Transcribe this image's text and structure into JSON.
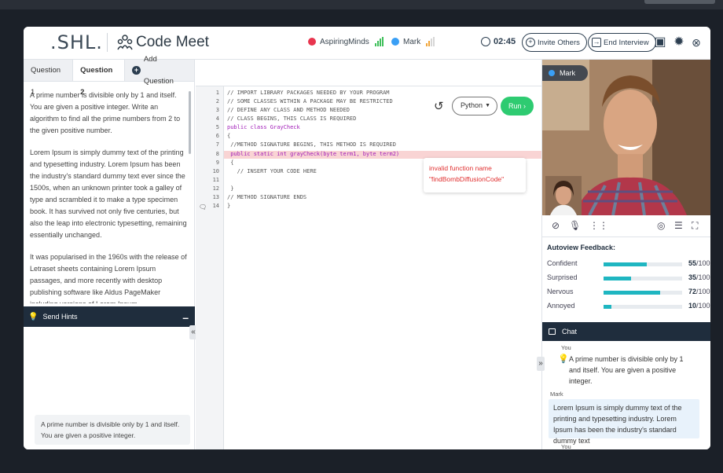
{
  "header": {
    "logo": ".SHL.",
    "app_title": "Code Meet",
    "participants": [
      {
        "name": "AspiringMinds",
        "dot_color": "#e8354e"
      },
      {
        "name": "Mark",
        "dot_color": "#3a9ff5"
      }
    ],
    "timer": "02:45",
    "invite_label": "Invite Others",
    "end_label": "End Interview"
  },
  "tabs": {
    "q1": "Question 1",
    "q2": "Question 2",
    "add": "Add Question"
  },
  "question": {
    "para1": "A prime number is divisible only by 1 and itself. You are given a positive integer. Write an algorithm to find all the prime numbers from 2 to the given positive number.",
    "para2": "Lorem Ipsum is simply dummy text of the printing and typesetting industry. Lorem Ipsum has been the industry's standard dummy text ever since the 1500s, when an unknown printer took a galley of type and scrambled it to make a type specimen book. It has survived not only five centuries, but also the leap into electronic typesetting, remaining essentially unchanged.",
    "para3": "It was popularised in the 1960s with the release of Letraset sheets containing Lorem Ipsum passages, and more recently with desktop publishing software like Aldus PageMaker including versions of Lorem Ipsum."
  },
  "hints": {
    "label": "Send Hints",
    "card": "A prime number is divisible only by 1 and itself. You are given a positive integer."
  },
  "editor": {
    "language": "Python",
    "run_label": "Run",
    "line_numbers": [
      "1",
      "2",
      "3",
      "4",
      "5",
      "6",
      "7",
      "8",
      "9",
      "10",
      "11",
      "12",
      "13",
      "14"
    ],
    "lines": [
      "// IMPORT LIBRARY PACKAGES NEEDED BY YOUR PROGRAM",
      "// SOME CLASSES WITHIN A PACKAGE MAY BE RESTRICTED",
      "// DEFINE ANY CLASS AND METHOD NEEDED",
      "// CLASS BEGINS, THIS CLASS IS REQUIRED",
      "public class GrayCheck",
      "{",
      " //METHOD SIGNATURE BEGINS, THIS METHOD IS REQUIRED",
      " public static int grayCheck(byte term1, byte term2)",
      " {",
      "   // INSERT YOUR CODE HERE",
      "",
      " }",
      "// METHOD SIGNATURE ENDS",
      "}"
    ],
    "error_line1": "invalid function name",
    "error_line2": "\"findBombDiffusionCode\""
  },
  "video": {
    "name": "Mark"
  },
  "feedback": {
    "title": "Autoview Feedback:",
    "rows": [
      {
        "label": "Confident",
        "value": "55",
        "suffix": "/100",
        "level": 0.55
      },
      {
        "label": "Surprised",
        "value": "35",
        "suffix": "/100",
        "level": 0.35
      },
      {
        "label": "Nervous",
        "value": "72",
        "suffix": "/100",
        "level": 0.72
      },
      {
        "label": "Annoyed",
        "value": "10",
        "suffix": "/100",
        "level": 0.1
      }
    ]
  },
  "chat": {
    "title": "Chat",
    "messages": [
      {
        "author": "You",
        "text": "A prime number is divisible only by 1 and itself. You are given a positive integer."
      },
      {
        "author": "Mark",
        "text": "Lorem Ipsum is simply dummy text of the printing and typesetting industry. Lorem Ipsum has been the industry's standard dummy text"
      }
    ],
    "next_author": "You"
  }
}
